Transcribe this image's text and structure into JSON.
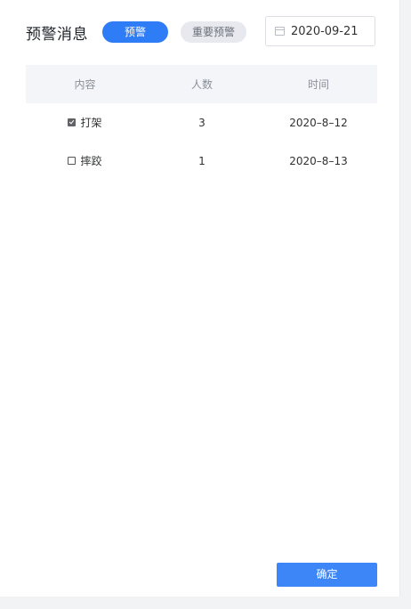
{
  "header": {
    "title": "预警消息",
    "tab_warning": "预警",
    "tab_important": "重要预警",
    "date_value": "2020-09-21"
  },
  "table": {
    "columns": [
      "内容",
      "人数",
      "时间"
    ],
    "rows": [
      {
        "checked": true,
        "content": "打架",
        "count": "3",
        "time": "2020–8–12"
      },
      {
        "checked": false,
        "content": "摔跤",
        "count": "1",
        "time": "2020–8–13"
      }
    ]
  },
  "footer": {
    "confirm_label": "确定"
  },
  "colors": {
    "primary": "#2e7cf6",
    "secondary_pill": "#e7e9ef",
    "table_header_bg": "#f4f5f8"
  },
  "icons": [
    "calendar-icon",
    "checkbox-checked",
    "checkbox-unchecked"
  ]
}
